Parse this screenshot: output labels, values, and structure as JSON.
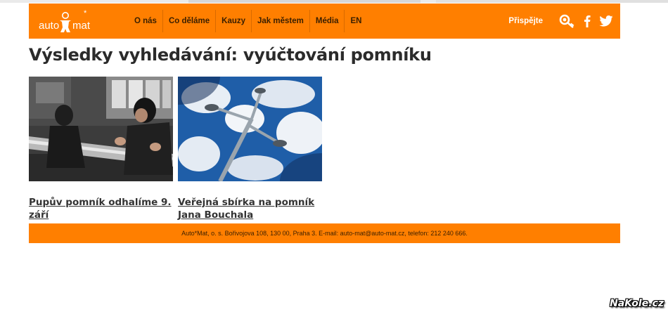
{
  "header": {
    "logo": {
      "left_text": "auto",
      "right_text": "mat",
      "star": "*"
    },
    "nav": [
      {
        "label": "O nás"
      },
      {
        "label": "Co děláme"
      },
      {
        "label": "Kauzy"
      },
      {
        "label": "Jak městem"
      },
      {
        "label": "Média"
      },
      {
        "label": "EN"
      }
    ],
    "donate_label": "Přispějte",
    "icons": [
      "search-key-icon",
      "facebook-icon",
      "twitter-icon"
    ]
  },
  "page_title": "Výsledky vyhledávání: vyúčtování pomníku",
  "results": [
    {
      "title": "Pupův pomník odhalíme 9. září",
      "image": "workshop-photo"
    },
    {
      "title": "Veřejná sbírka na pomník Jana Bouchala",
      "image": "street-lamp-sky-photo"
    }
  ],
  "footer": {
    "text": "Auto*Mat, o. s. Bořivojova 108, 130 00, Praha 3. E-mail: auto-mat@auto-mat.cz, telefon: 212 240 666."
  },
  "watermark": "NaKole.cz",
  "colors": {
    "brand": "#ff7f00",
    "nav_text": "#3a1f00"
  }
}
